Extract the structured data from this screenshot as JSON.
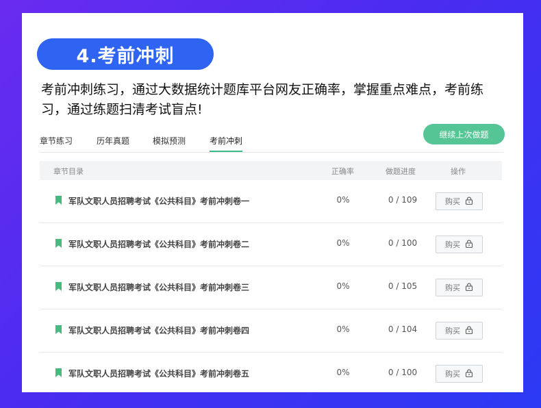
{
  "header": {
    "title": "4.考前冲刺"
  },
  "intro": {
    "text": "考前冲刺练习，通过大数据统计题库平台网友正确率，掌握重点难点，考前练习，通过练题扫清考试盲点!"
  },
  "tabs": [
    {
      "label": "章节练习"
    },
    {
      "label": "历年真题"
    },
    {
      "label": "模拟预测"
    },
    {
      "label": "考前冲刺",
      "active": true
    }
  ],
  "continue_button": {
    "label": "继续上次做题"
  },
  "table": {
    "columns": {
      "name": "章节目录",
      "rate": "正确率",
      "progress": "做题进度",
      "action": "操作"
    },
    "rows": [
      {
        "title": "军队文职人员招聘考试《公共科目》考前冲刺卷一",
        "rate": "0%",
        "progress": "0 / 109",
        "action": "购买"
      },
      {
        "title": "军队文职人员招聘考试《公共科目》考前冲刺卷二",
        "rate": "0%",
        "progress": "0 / 100",
        "action": "购买"
      },
      {
        "title": "军队文职人员招聘考试《公共科目》考前冲刺卷三",
        "rate": "0%",
        "progress": "0 / 105",
        "action": "购买"
      },
      {
        "title": "军队文职人员招聘考试《公共科目》考前冲刺卷四",
        "rate": "0%",
        "progress": "0 / 104",
        "action": "购买"
      },
      {
        "title": "军队文职人员招聘考试《公共科目》考前冲刺卷五",
        "rate": "0%",
        "progress": "0 / 100",
        "action": "购买"
      }
    ]
  },
  "colors": {
    "accent": "#2f63f2",
    "green": "#56c596",
    "bookmark": "#49b980"
  },
  "icons": {
    "row": "bookmark-icon",
    "buy": "lock-icon"
  }
}
